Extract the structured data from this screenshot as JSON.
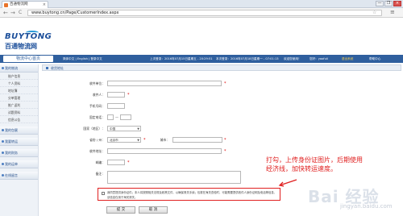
{
  "browser": {
    "tab_title": "百通物流网",
    "url": "www.buytong.cn/Page/CustomerIndex.aspx",
    "close_tab": "×",
    "back": "←",
    "forward": "→",
    "reload": "C",
    "window_controls": [
      "—",
      "❐",
      "×"
    ]
  },
  "logo": {
    "en": "BUYTONG",
    "cn": "百通物流网"
  },
  "topbar": {
    "home_button": "物流中心首页",
    "language": "简体中文 | English | 登录中文",
    "last_login": "上次登录：2016年07月15日星期五 - 20:29:51",
    "this_login": "本次登录：2016年07月18日星期一 - 07:01:13",
    "welcome": "欢迎您使用！",
    "user": "您好：yaofuli",
    "logout": "退出系统",
    "help": "帮助中心"
  },
  "sidebar": {
    "sections": [
      {
        "label": "我的物流",
        "items": [
          "账户信息",
          "个人资料",
          "地址簿",
          "分单管理",
          "推广返利",
          "试题资料",
          "信息公告"
        ]
      },
      {
        "label": "我的包裹",
        "items": []
      },
      {
        "label": "我要转运",
        "items": []
      },
      {
        "label": "我的财务",
        "items": []
      },
      {
        "label": "我的运单",
        "items": []
      },
      {
        "label": "在线留言",
        "items": []
      }
    ]
  },
  "form": {
    "panel_title": "收货地址",
    "fields": {
      "company": "收件单位：",
      "name": "收件人：",
      "pinyin": "手机号码：",
      "phone": "固定电话：",
      "country": "国家（地区）：",
      "province": "省份 / 州：",
      "city": "城市：",
      "address": "收件地址：",
      "zip": "邮编：",
      "remark": "备注："
    },
    "country_value": "中国",
    "province_value": "北京市",
    "required_mark": "*",
    "phone_dash": "—",
    "agree_text": "我同意提供身份证件；本人将按照相关法规及政策文件，以确保清关手续；包裹在海关查验时，可能需要提供收件人身份证明及电话等信息，该信息仅用于海关清关。"
  },
  "buttons": {
    "submit": "提 交",
    "cancel": "取 消"
  },
  "annotation": "打勾，上传身份证图片，后期使用经济线，加快转运速度。",
  "watermark": {
    "text": "Bai 经验",
    "sub": "jingyan.baidu.com"
  },
  "colors": {
    "brand": "#2f5f9e",
    "annotation": "#e02020"
  }
}
